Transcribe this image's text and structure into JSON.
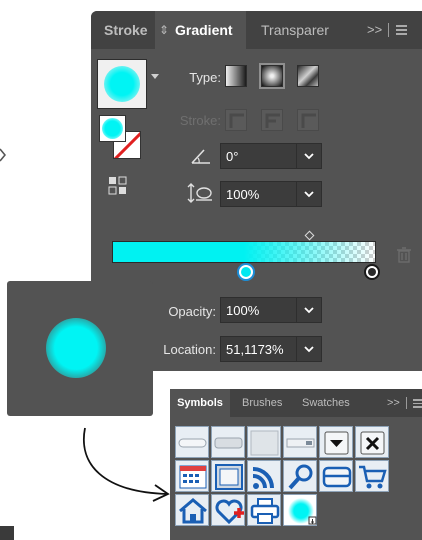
{
  "gradient_panel": {
    "tabs": [
      "Stroke",
      "Gradient",
      "Transparer"
    ],
    "tab_arrows": "⇕",
    "more": ">>",
    "type_label": "Type:",
    "stroke_label": "Stroke:",
    "angle_value": "0°",
    "aspect_value": "100%",
    "opacity_label": "Opacity:",
    "opacity_value": "100%",
    "location_label": "Location:",
    "location_value": "51,1173%",
    "colors": {
      "panel": "#535353",
      "tabbar": "#424242",
      "gradient_start": "#00f2f2",
      "accent_stop": "#1c8ed8"
    }
  },
  "symbols_panel": {
    "tabs": [
      "Symbols",
      "Brushes",
      "Swatches"
    ],
    "more": ">>",
    "icons": [
      "pill-button-icon",
      "rounded-button-icon",
      "square-button-icon",
      "slider-field-icon",
      "dropdown-arrow-icon",
      "close-x-icon",
      "calendar-icon",
      "filmstrip-icon",
      "rss-icon",
      "magnifier-icon",
      "card-icon",
      "cart-icon",
      "home-icon",
      "heart-add-icon",
      "printer-icon",
      "cyan-blur-symbol-icon"
    ]
  }
}
